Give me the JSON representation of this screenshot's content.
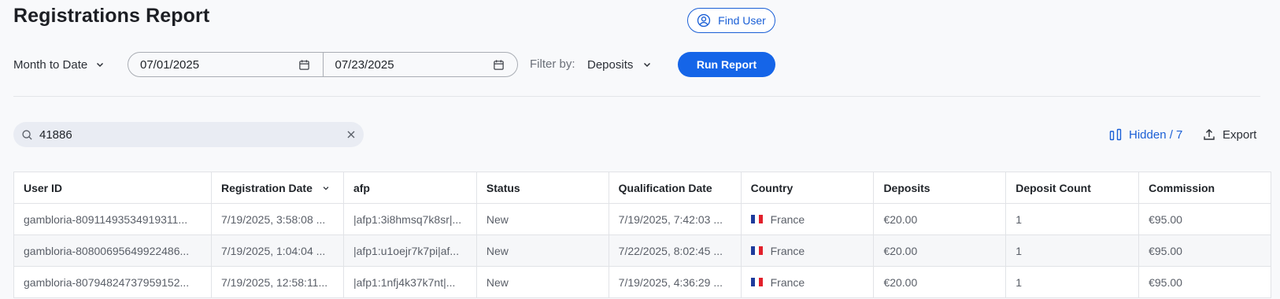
{
  "page": {
    "title": "Registrations Report"
  },
  "header": {
    "find_user_label": "Find User"
  },
  "filters": {
    "range_label": "Month to Date",
    "start_date": "07/01/2025",
    "end_date": "07/23/2025",
    "filter_by_label": "Filter by:",
    "filter_value": "Deposits",
    "run_label": "Run Report"
  },
  "toolbar": {
    "search_value": "41886",
    "hidden_label": "Hidden / 7",
    "export_label": "Export"
  },
  "colors": {
    "accent": "#1565e8",
    "link": "#1a5fd6"
  },
  "table": {
    "columns": [
      "User ID",
      "Registration Date",
      "afp",
      "Status",
      "Qualification Date",
      "Country",
      "Deposits",
      "Deposit Count",
      "Commission"
    ],
    "rows": [
      [
        "gambloria-80911493534919311...",
        "7/19/2025, 3:58:08 ...",
        "|afp1:3i8hmsq7k8sr|...",
        "New",
        "7/19/2025, 7:42:03 ...",
        "France",
        "€20.00",
        "1",
        "€95.00"
      ],
      [
        "gambloria-80800695649922486...",
        "7/19/2025, 1:04:04 ...",
        "|afp1:u1oejr7k7pi|af...",
        "New",
        "7/22/2025, 8:02:45 ...",
        "France",
        "€20.00",
        "1",
        "€95.00"
      ],
      [
        "gambloria-80794824737959152...",
        "7/19/2025, 12:58:11...",
        "|afp1:1nfj4k37k7nt|...",
        "New",
        "7/19/2025, 4:36:29 ...",
        "France",
        "€20.00",
        "1",
        "€95.00"
      ]
    ]
  }
}
